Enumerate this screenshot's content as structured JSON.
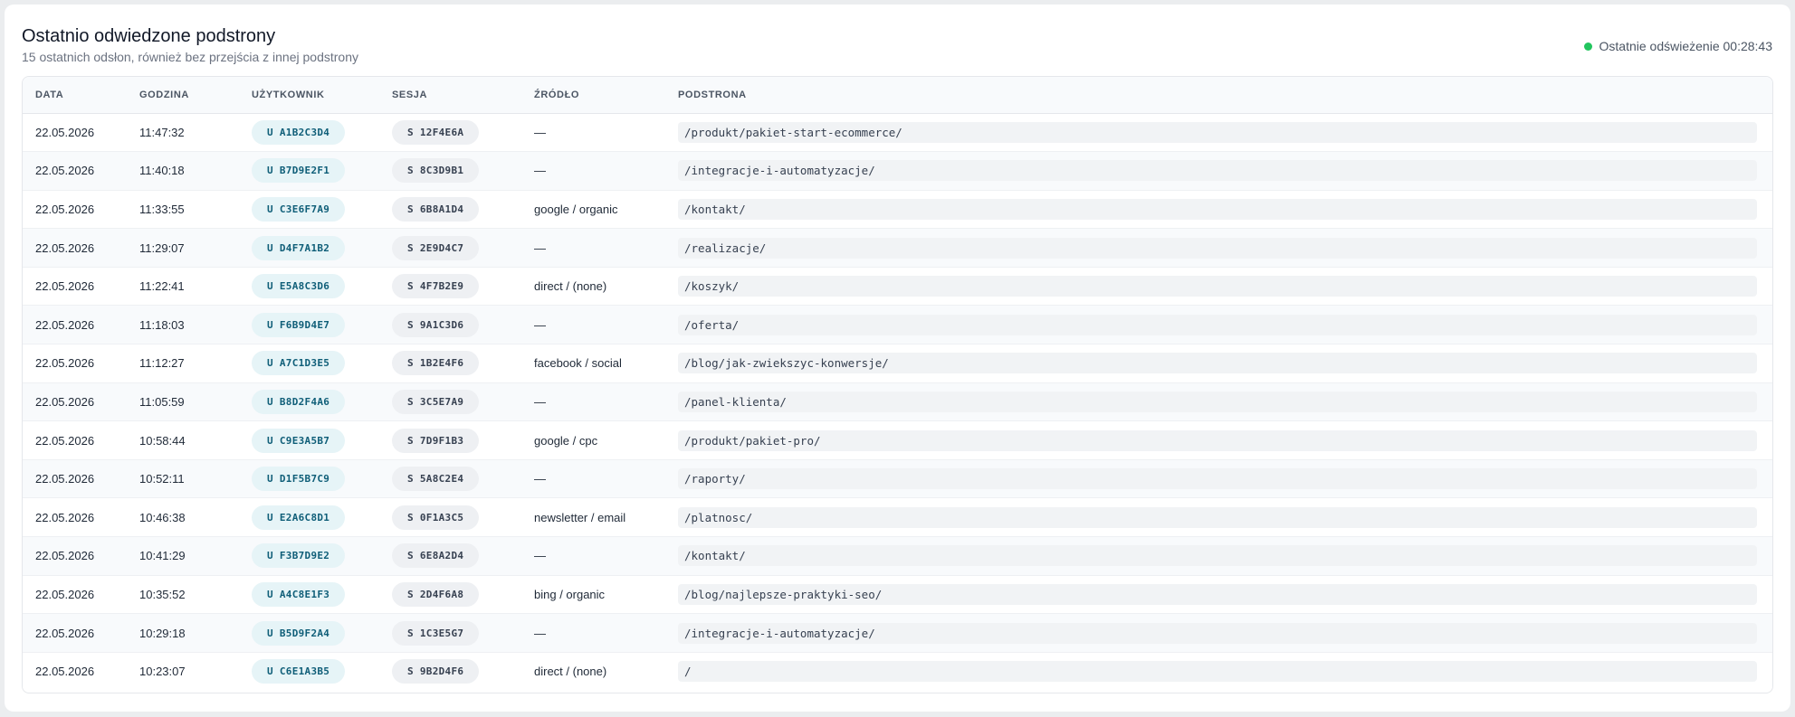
{
  "header": {
    "title": "Ostatnio odwiedzone podstrony",
    "subtitle": "15 ostatnich odsłon, również bez przejścia z innej podstrony",
    "refresh_label": "Ostatnie odświeżenie 00:28:43",
    "status_color": "#22c55e"
  },
  "table": {
    "columns": [
      "DATA",
      "GODZINA",
      "UŻYTKOWNIK",
      "SESJA",
      "ŹRÓDŁO",
      "PODSTRONA"
    ],
    "rows": [
      {
        "date": "22.05.2026",
        "time": "11:47:32",
        "user": "U A1B2C3D4",
        "session": "S 12F4E6A",
        "source": "—",
        "page": "/produkt/pakiet-start-ecommerce/"
      },
      {
        "date": "22.05.2026",
        "time": "11:40:18",
        "user": "U B7D9E2F1",
        "session": "S 8C3D9B1",
        "source": "—",
        "page": "/integracje-i-automatyzacje/"
      },
      {
        "date": "22.05.2026",
        "time": "11:33:55",
        "user": "U C3E6F7A9",
        "session": "S 6B8A1D4",
        "source": "google / organic",
        "page": "/kontakt/"
      },
      {
        "date": "22.05.2026",
        "time": "11:29:07",
        "user": "U D4F7A1B2",
        "session": "S 2E9D4C7",
        "source": "—",
        "page": "/realizacje/"
      },
      {
        "date": "22.05.2026",
        "time": "11:22:41",
        "user": "U E5A8C3D6",
        "session": "S 4F7B2E9",
        "source": "direct / (none)",
        "page": "/koszyk/"
      },
      {
        "date": "22.05.2026",
        "time": "11:18:03",
        "user": "U F6B9D4E7",
        "session": "S 9A1C3D6",
        "source": "—",
        "page": "/oferta/"
      },
      {
        "date": "22.05.2026",
        "time": "11:12:27",
        "user": "U A7C1D3E5",
        "session": "S 1B2E4F6",
        "source": "facebook / social",
        "page": "/blog/jak-zwiekszyc-konwersje/"
      },
      {
        "date": "22.05.2026",
        "time": "11:05:59",
        "user": "U B8D2F4A6",
        "session": "S 3C5E7A9",
        "source": "—",
        "page": "/panel-klienta/"
      },
      {
        "date": "22.05.2026",
        "time": "10:58:44",
        "user": "U C9E3A5B7",
        "session": "S 7D9F1B3",
        "source": "google / cpc",
        "page": "/produkt/pakiet-pro/"
      },
      {
        "date": "22.05.2026",
        "time": "10:52:11",
        "user": "U D1F5B7C9",
        "session": "S 5A8C2E4",
        "source": "—",
        "page": "/raporty/"
      },
      {
        "date": "22.05.2026",
        "time": "10:46:38",
        "user": "U E2A6C8D1",
        "session": "S 0F1A3C5",
        "source": "newsletter / email",
        "page": "/platnosc/"
      },
      {
        "date": "22.05.2026",
        "time": "10:41:29",
        "user": "U F3B7D9E2",
        "session": "S 6E8A2D4",
        "source": "—",
        "page": "/kontakt/"
      },
      {
        "date": "22.05.2026",
        "time": "10:35:52",
        "user": "U A4C8E1F3",
        "session": "S 2D4F6A8",
        "source": "bing / organic",
        "page": "/blog/najlepsze-praktyki-seo/"
      },
      {
        "date": "22.05.2026",
        "time": "10:29:18",
        "user": "U B5D9F2A4",
        "session": "S 1C3E5G7",
        "source": "—",
        "page": "/integracje-i-automatyzacje/"
      },
      {
        "date": "22.05.2026",
        "time": "10:23:07",
        "user": "U C6E1A3B5",
        "session": "S 9B2D4F6",
        "source": "direct / (none)",
        "page": "/"
      }
    ]
  }
}
